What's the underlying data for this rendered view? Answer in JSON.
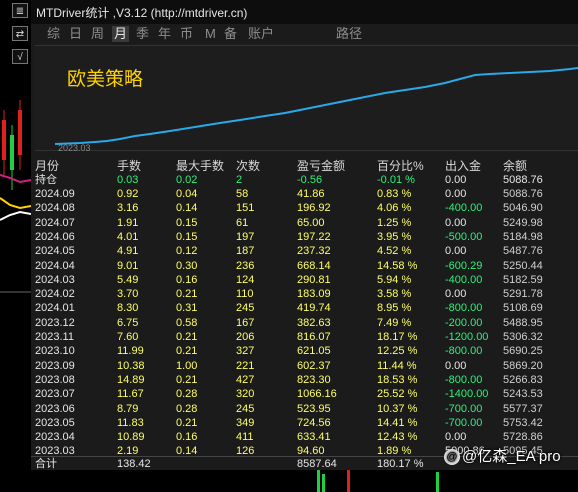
{
  "window": {
    "title": "MTDriver统计 ,V3.12 (http://mtdriver.cn)"
  },
  "left_icons": [
    "≣",
    "⇄",
    "√"
  ],
  "tabs": [
    {
      "label": "综",
      "active": false
    },
    {
      "label": "日",
      "active": false
    },
    {
      "label": "周",
      "active": false
    },
    {
      "label": "月",
      "active": true
    },
    {
      "label": "季",
      "active": false
    },
    {
      "label": "年",
      "active": false
    },
    {
      "label": "币",
      "active": false
    },
    {
      "label": "M",
      "active": false
    },
    {
      "label": "备",
      "active": false
    },
    {
      "label": "账户",
      "active": false
    },
    {
      "label": "路径",
      "active": false
    }
  ],
  "chart": {
    "strategy_name": "欧美策略",
    "start_label": "2023.03",
    "line_color": "#2aa8e8"
  },
  "table": {
    "headers": [
      "月份",
      "手数",
      "最大手数",
      "次数",
      "盈亏金额",
      "百分比%",
      "出入金",
      "余额"
    ],
    "holding": {
      "label": "持仓",
      "lots": "0.03",
      "max_lots": "0.02",
      "count": "2",
      "pnl": "-0.56",
      "pct": "-0.01 %",
      "flow": "0.00",
      "balance": "5088.76"
    },
    "rows": [
      [
        "2024.09",
        "0.92",
        "0.04",
        "58",
        "41.86",
        "0.83 %",
        "0.00",
        "5088.76"
      ],
      [
        "2024.08",
        "3.16",
        "0.14",
        "151",
        "196.92",
        "4.06 %",
        "-400.00",
        "5046.90"
      ],
      [
        "2024.07",
        "1.91",
        "0.15",
        "61",
        "65.00",
        "1.25 %",
        "0.00",
        "5249.98"
      ],
      [
        "2024.06",
        "4.01",
        "0.15",
        "197",
        "197.22",
        "3.95 %",
        "-500.00",
        "5184.98"
      ],
      [
        "2024.05",
        "4.91",
        "0.12",
        "187",
        "237.32",
        "4.52 %",
        "0.00",
        "5487.76"
      ],
      [
        "2024.04",
        "9.01",
        "0.30",
        "236",
        "668.14",
        "14.58 %",
        "-600.29",
        "5250.44"
      ],
      [
        "2024.03",
        "5.49",
        "0.16",
        "124",
        "290.81",
        "5.94 %",
        "-400.00",
        "5182.59"
      ],
      [
        "2024.02",
        "3.70",
        "0.21",
        "110",
        "183.09",
        "3.58 %",
        "0.00",
        "5291.78"
      ],
      [
        "2024.01",
        "8.30",
        "0.31",
        "245",
        "419.74",
        "8.95 %",
        "-800.00",
        "5108.69"
      ],
      [
        "2023.12",
        "6.75",
        "0.58",
        "167",
        "382.63",
        "7.49 %",
        "-200.00",
        "5488.95"
      ],
      [
        "2023.11",
        "7.60",
        "0.21",
        "206",
        "816.07",
        "18.17 %",
        "-1200.00",
        "5306.32"
      ],
      [
        "2023.10",
        "11.99",
        "0.21",
        "327",
        "621.05",
        "12.25 %",
        "-800.00",
        "5690.25"
      ],
      [
        "2023.09",
        "10.38",
        "1.00",
        "221",
        "602.37",
        "11.44 %",
        "0.00",
        "5869.20"
      ],
      [
        "2023.08",
        "14.89",
        "0.21",
        "427",
        "823.30",
        "18.53 %",
        "-800.00",
        "5266.83"
      ],
      [
        "2023.07",
        "11.67",
        "0.28",
        "320",
        "1066.16",
        "25.52 %",
        "-1400.00",
        "5243.53"
      ],
      [
        "2023.06",
        "8.79",
        "0.28",
        "245",
        "523.95",
        "10.37 %",
        "-700.00",
        "5577.37"
      ],
      [
        "2023.05",
        "11.83",
        "0.21",
        "349",
        "724.56",
        "14.41 %",
        "-700.00",
        "5753.42"
      ],
      [
        "2023.04",
        "10.89",
        "0.16",
        "411",
        "633.41",
        "12.43 %",
        "0.00",
        "5728.86"
      ],
      [
        "2023.03",
        "2.19",
        "0.14",
        "126",
        "94.60",
        "1.89 %",
        "5000.86",
        "5095.45"
      ]
    ],
    "total": {
      "label": "合计",
      "lots": "138.42",
      "pnl": "8587.64",
      "pct": "180.17 %"
    }
  },
  "watermark": {
    "icon": "@",
    "text": "@亿森_EA pro"
  }
}
